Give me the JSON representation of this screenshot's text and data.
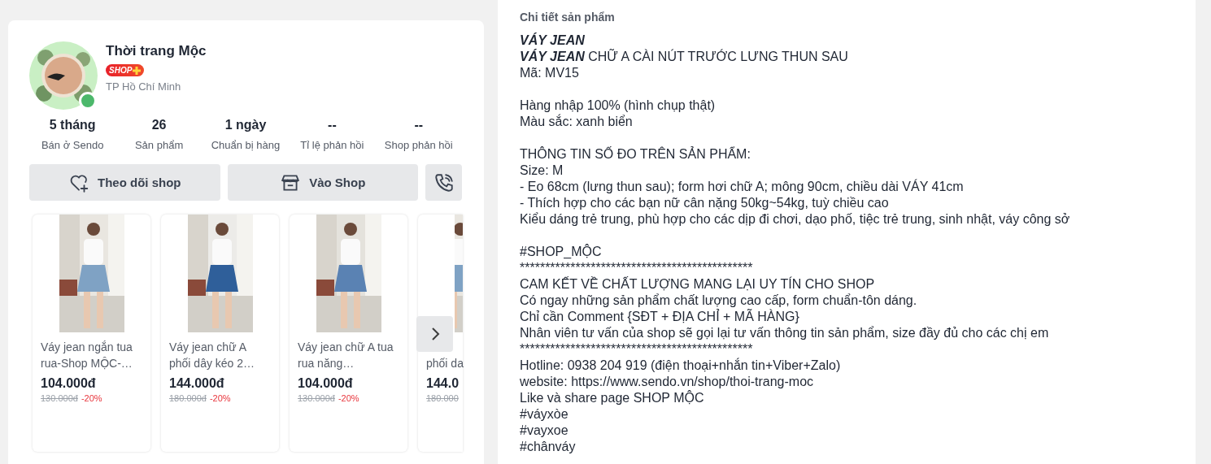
{
  "shop": {
    "name": "Thời trang Mộc",
    "badge": "SHOP",
    "location": "TP Hồ Chí Minh",
    "online": true,
    "stats": [
      {
        "value": "5 tháng",
        "label": "Bán ở Sendo"
      },
      {
        "value": "26",
        "label": "Sản phẩm"
      },
      {
        "value": "1 ngày",
        "label": "Chuẩn bị hàng"
      },
      {
        "value": "--",
        "label": "Tỉ lệ phản hồi"
      },
      {
        "value": "--",
        "label": "Shop phản hồi"
      }
    ],
    "buttons": [
      {
        "kind": "follow",
        "label": "Theo dõi shop"
      },
      {
        "kind": "store",
        "label": "Vào Shop"
      },
      {
        "kind": "call"
      }
    ]
  },
  "products": [
    {
      "title": "Váy jean ngắn tua rua-Shop MỘC-…",
      "price": "104.000đ",
      "old_price": "130.000đ",
      "discount": "-20%"
    },
    {
      "title": "Váy jean chữ A phối dây kéo 2…",
      "price": "144.000đ",
      "old_price": "180.000đ",
      "discount": "-20%"
    },
    {
      "title": "Váy jean chữ A tua rua năng…",
      "price": "104.000đ",
      "old_price": "130.000đ",
      "discount": "-20%"
    },
    {
      "title": "phối da",
      "price": "144.0",
      "old_price": "180.000",
      "partial": true
    }
  ],
  "details": {
    "title": "Chi tiết sản phẩm",
    "heading": "VÁY JEAN",
    "subheading": "**VÁY JEAN** CHỮ A CÀI NÚT TRƯỚC LƯNG THUN SAU",
    "paragraphs": [
      [
        "Mã: MV15"
      ],
      [
        "Hàng nhập 100% (hình chụp thật)",
        "Màu sắc: xanh biển"
      ],
      [
        "THÔNG TIN SỐ ĐO TRÊN SẢN PHẨM:",
        "Size: M",
        "- Eo 68cm (lưng thun sau); form hơi chữ A; mông 90cm, chiều dài VÁY 41cm",
        "- Thích hợp cho các bạn nữ cân nặng 50kg~54kg, tuỳ chiều cao",
        "Kiểu dáng trẻ trung, phù hợp cho các dịp đi chơi, dạo phố, tiệc trẻ trung, sinh nhật, váy công sở"
      ],
      [
        "#SHOP_MỘC",
        "**********************************************",
        "CAM KẾT VỀ CHẤT LƯỢNG MANG LẠI UY TÍN CHO SHOP",
        "Có ngay những sản phẩm chất lượng cao cấp, form chuẩn-tôn dáng.",
        "Chỉ cần Comment {SĐT + ĐỊA CHỈ + MÃ HÀNG}",
        "Nhân viên tư vấn của shop sẽ gọi lại tư vấn thông tin sản phẩm, size đầy đủ cho các chị em",
        "**********************************************",
        "Hotline: 0938 204 919 (điện thoại+nhắn tin+Viber+Zalo)",
        "website: https://www.sendo.vn/shop/thoi-trang-moc",
        "Like và share page SHOP MỘC",
        "#váyxòe",
        "#vayxoe",
        "#chânváy"
      ]
    ]
  }
}
